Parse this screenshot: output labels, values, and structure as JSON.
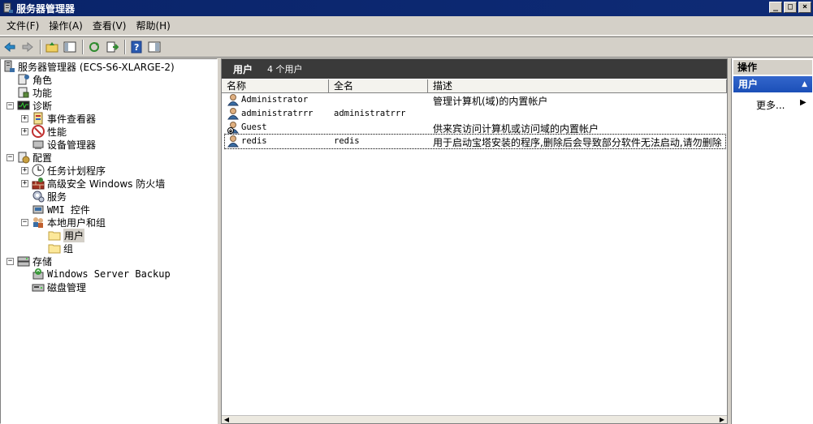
{
  "window": {
    "title": "服务器管理器",
    "min": "_",
    "max": "□",
    "close": "×"
  },
  "menu": [
    "文件(F)",
    "操作(A)",
    "查看(V)",
    "帮助(H)"
  ],
  "tree": {
    "root": "服务器管理器 (ECS-S6-XLARGE-2)",
    "roles": "角色",
    "features": "功能",
    "diagnostics": "诊断",
    "event_viewer": "事件查看器",
    "performance": "性能",
    "device_manager": "设备管理器",
    "configuration": "配置",
    "task_scheduler": "任务计划程序",
    "firewall": "高级安全 Windows 防火墙",
    "services": "服务",
    "wmi": "WMI 控件",
    "local_users": "本地用户和组",
    "users": "用户",
    "groups": "组",
    "storage": "存储",
    "backup": "Windows Server Backup",
    "disk": "磁盘管理"
  },
  "center": {
    "title": "用户",
    "count": "4 个用户",
    "columns": [
      "名称",
      "全名",
      "描述"
    ],
    "rows": [
      {
        "name": "Administrator",
        "fullname": "",
        "desc": "管理计算机(域)的内置帐户"
      },
      {
        "name": "administratrrr",
        "fullname": "administratrrr",
        "desc": ""
      },
      {
        "name": "Guest",
        "fullname": "",
        "desc": "供来宾访问计算机或访问域的内置帐户"
      },
      {
        "name": "redis",
        "fullname": "redis",
        "desc": "用于启动宝塔安装的程序,删除后会导致部分软件无法启动,请勿删除"
      }
    ]
  },
  "actions": {
    "header": "操作",
    "section": "用户",
    "more": "更多..."
  }
}
